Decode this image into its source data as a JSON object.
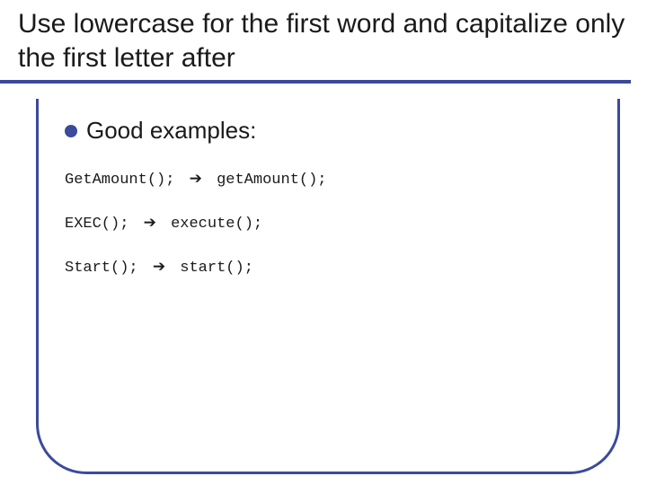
{
  "title": "Use lowercase for the first word and capitalize only the first letter after",
  "bullet": {
    "label": "Good examples:"
  },
  "examples": [
    {
      "before": "GetAmount();",
      "after": "getAmount();",
      "arrow": "➔"
    },
    {
      "before": "EXEC();",
      "after": "execute();",
      "arrow": "➔"
    },
    {
      "before": "Start();",
      "after": "start();",
      "arrow": "➔"
    }
  ]
}
